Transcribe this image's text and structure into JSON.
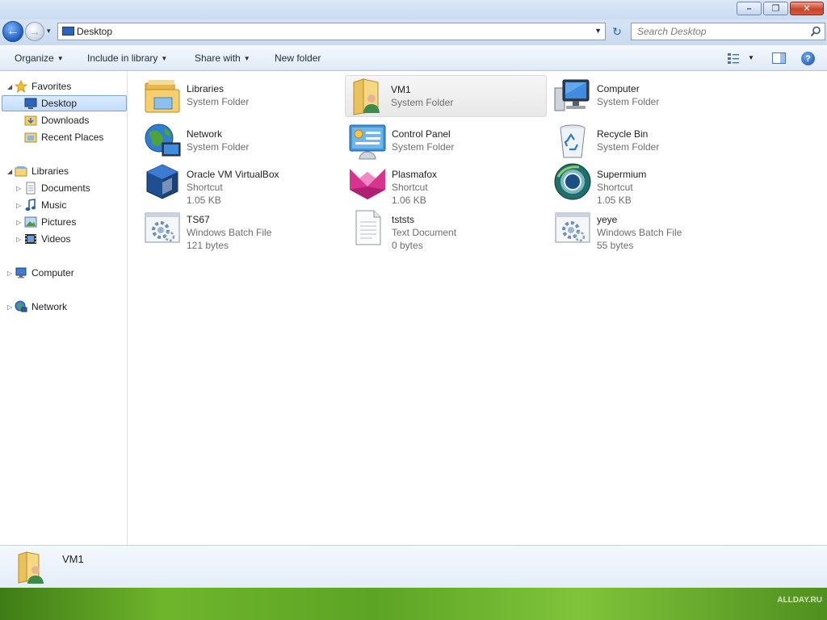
{
  "window": {
    "minimize": "–",
    "maximize": "❐",
    "close": "✕"
  },
  "navbar": {
    "back": "←",
    "forward": "→",
    "history": "▾",
    "address": "Desktop",
    "address_drop": "▼",
    "refresh": "↻",
    "search_placeholder": "Search Desktop"
  },
  "toolbar": {
    "organize": "Organize",
    "include": "Include in library",
    "share": "Share with",
    "new_folder": "New folder",
    "dropdown": "▼",
    "help": "?"
  },
  "tree": {
    "favorites": "Favorites",
    "desktop": "Desktop",
    "downloads": "Downloads",
    "recent": "Recent Places",
    "libraries": "Libraries",
    "documents": "Documents",
    "music": "Music",
    "pictures": "Pictures",
    "videos": "Videos",
    "computer": "Computer",
    "network": "Network",
    "expanded": "◢",
    "collapsed": "▷"
  },
  "items": [
    {
      "name": "Libraries",
      "line1": "System Folder",
      "line2": "",
      "icon": "libraries-icon"
    },
    {
      "name": "VM1",
      "line1": "System Folder",
      "line2": "",
      "icon": "user-folder-icon"
    },
    {
      "name": "Computer",
      "line1": "System Folder",
      "line2": "",
      "icon": "computer-icon"
    },
    {
      "name": "Network",
      "line1": "System Folder",
      "line2": "",
      "icon": "network-icon"
    },
    {
      "name": "Control Panel",
      "line1": "System Folder",
      "line2": "",
      "icon": "control-panel-icon"
    },
    {
      "name": "Recycle Bin",
      "line1": "System Folder",
      "line2": "",
      "icon": "recycle-bin-icon"
    },
    {
      "name": "Oracle VM VirtualBox",
      "line1": "Shortcut",
      "line2": "1.05 KB",
      "icon": "virtualbox-icon"
    },
    {
      "name": "Plasmafox",
      "line1": "Shortcut",
      "line2": "1.06 KB",
      "icon": "plasmafox-icon"
    },
    {
      "name": "Supermium",
      "line1": "Shortcut",
      "line2": "1.05 KB",
      "icon": "supermium-icon"
    },
    {
      "name": "TS67",
      "line1": "Windows Batch File",
      "line2": "121 bytes",
      "icon": "batch-file-icon"
    },
    {
      "name": "tststs",
      "line1": "Text Document",
      "line2": "0 bytes",
      "icon": "text-document-icon"
    },
    {
      "name": "yeye",
      "line1": "Windows Batch File",
      "line2": "55 bytes",
      "icon": "batch-file-icon"
    }
  ],
  "details": {
    "name": "VM1"
  },
  "watermark": "ALLDAY.RU",
  "colors": {
    "selection": "#c2dcfb",
    "accent": "#1d5cbe"
  }
}
